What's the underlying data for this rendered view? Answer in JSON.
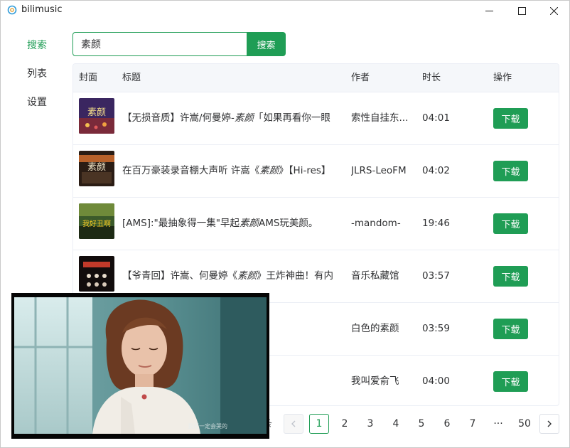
{
  "window": {
    "title": "bilimusic",
    "minimize_glyph": "─",
    "maximize_glyph": "☐",
    "close_glyph": "✕"
  },
  "sidebar": {
    "items": [
      {
        "label": "搜索",
        "active": true
      },
      {
        "label": "列表",
        "active": false
      },
      {
        "label": "设置",
        "active": false
      }
    ]
  },
  "search": {
    "value": "素颜",
    "button_label": "搜索"
  },
  "table": {
    "headers": {
      "cover": "封面",
      "title": "标题",
      "author": "作者",
      "duration": "时长",
      "action": "操作"
    },
    "rows": [
      {
        "title_parts": [
          "【无损音质】许嵩/何曼婷-",
          "素颜",
          "「如果再看你一眼"
        ],
        "author": "索性自挂东...",
        "duration": "04:01",
        "download_label": "下载",
        "cover_text": "素颜"
      },
      {
        "title_parts": [
          "在百万豪装录音棚大声听 许嵩《",
          "素颜",
          "》【Hi-res】"
        ],
        "author": "JLRS-LeoFM",
        "duration": "04:02",
        "download_label": "下载",
        "cover_text": "素颜"
      },
      {
        "title_parts": [
          "[AMS]:\"最抽象得一集\"早起",
          "素颜",
          "AMS玩美颜。"
        ],
        "author": "-mandom-",
        "duration": "19:46",
        "download_label": "下载",
        "cover_text": "我好丑啊"
      },
      {
        "title_parts": [
          "【爷青回】许嵩、何曼婷《",
          "素颜",
          "》王炸神曲！有内"
        ],
        "author": "音乐私藏馆",
        "duration": "03:57",
        "download_label": "下载",
        "cover_text": ""
      },
      {
        "title_parts": [
          "",
          "",
          ""
        ],
        "author": "白色的素颜",
        "duration": "03:59",
        "download_label": "下载",
        "cover_text": ""
      },
      {
        "title_parts": [
          "",
          "",
          ""
        ],
        "author": "我叫爱俞飞",
        "duration": "04:00",
        "download_label": "下载",
        "cover_text": ""
      }
    ]
  },
  "pagination": {
    "partial_text": "条",
    "pages": [
      "1",
      "2",
      "3",
      "4",
      "5",
      "6",
      "7",
      "···",
      "50"
    ],
    "current": "1"
  },
  "video": {
    "subtitle": "我还一定会哭的"
  },
  "colors": {
    "accent": "#1f9d55",
    "border": "#ebeef5",
    "header_bg": "#f5f7fa"
  }
}
